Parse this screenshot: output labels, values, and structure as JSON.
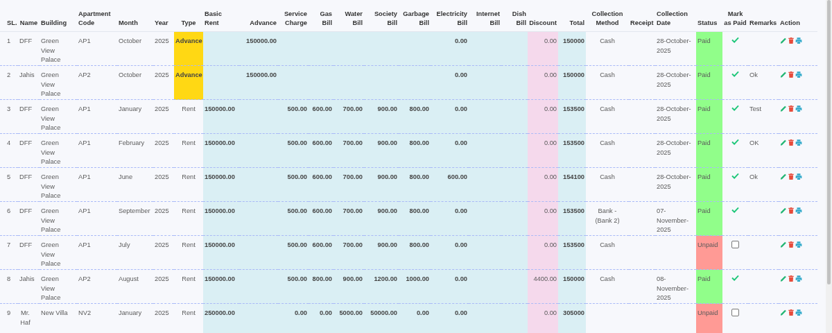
{
  "table": {
    "columns": [
      "SL.",
      "Name",
      "Building",
      "Apartment Code",
      "Month",
      "Year",
      "Type",
      "Basic Rent",
      "Advance",
      "Service Charge",
      "Gas Bill",
      "Water Bill",
      "Society Bill",
      "Garbage Bill",
      "Electricity Bill",
      "Internet Bill",
      "Dish Bill",
      "Discount",
      "Total",
      "Collection Method",
      "Receipt",
      "Collection Date",
      "Status",
      "Mark as Paid",
      "Remarks",
      "Action"
    ],
    "rows": [
      {
        "sl": "1",
        "name": "DFF",
        "building": "Green View Palace",
        "apartment_code": "AP1",
        "month": "October",
        "year": "2025",
        "type": "Advance",
        "type_highlighted": true,
        "advance": "150000.00",
        "electricity_bill": "0.00",
        "discount": "0.00",
        "total": "150000",
        "collection_method": "Cash",
        "collection_date": "28-October-2025",
        "status": "Paid",
        "paid": true
      },
      {
        "sl": "2",
        "name": "Jahis",
        "building": "Green View Palace",
        "apartment_code": "AP2",
        "month": "October",
        "year": "2025",
        "type": "Advance",
        "type_highlighted": true,
        "advance": "150000.00",
        "electricity_bill": "0.00",
        "discount": "0.00",
        "total": "150000",
        "collection_method": "Cash",
        "collection_date": "28-October-2025",
        "status": "Paid",
        "paid": true,
        "remarks": "Ok"
      },
      {
        "sl": "3",
        "name": "DFF",
        "building": "Green View Palace",
        "apartment_code": "AP1",
        "month": "January",
        "year": "2025",
        "type": "Rent",
        "type_highlighted": false,
        "basic_rent": "150000.00",
        "service_charge": "500.00",
        "gas_bill": "600.00",
        "water_bill": "700.00",
        "society_bill": "900.00",
        "garbage_bill": "800.00",
        "electricity_bill": "0.00",
        "discount": "0.00",
        "total": "153500",
        "collection_method": "Cash",
        "collection_date": "28-October-2025",
        "status": "Paid",
        "paid": true,
        "remarks": "Test"
      },
      {
        "sl": "4",
        "name": "DFF",
        "building": "Green View Palace",
        "apartment_code": "AP1",
        "month": "February",
        "year": "2025",
        "type": "Rent",
        "type_highlighted": false,
        "basic_rent": "150000.00",
        "service_charge": "500.00",
        "gas_bill": "600.00",
        "water_bill": "700.00",
        "society_bill": "900.00",
        "garbage_bill": "800.00",
        "electricity_bill": "0.00",
        "discount": "0.00",
        "total": "153500",
        "collection_method": "Cash",
        "collection_date": "28-October-2025",
        "status": "Paid",
        "paid": true,
        "remarks": "OK"
      },
      {
        "sl": "5",
        "name": "DFF",
        "building": "Green View Palace",
        "apartment_code": "AP1",
        "month": "June",
        "year": "2025",
        "type": "Rent",
        "type_highlighted": false,
        "basic_rent": "150000.00",
        "service_charge": "500.00",
        "gas_bill": "600.00",
        "water_bill": "700.00",
        "society_bill": "900.00",
        "garbage_bill": "800.00",
        "electricity_bill": "600.00",
        "discount": "0.00",
        "total": "154100",
        "collection_method": "Cash",
        "collection_date": "28-October-2025",
        "status": "Paid",
        "paid": true,
        "remarks": "Ok"
      },
      {
        "sl": "6",
        "name": "DFF",
        "building": "Green View Palace",
        "apartment_code": "AP1",
        "month": "September",
        "year": "2025",
        "type": "Rent",
        "type_highlighted": false,
        "basic_rent": "150000.00",
        "service_charge": "500.00",
        "gas_bill": "600.00",
        "water_bill": "700.00",
        "society_bill": "900.00",
        "garbage_bill": "800.00",
        "electricity_bill": "0.00",
        "discount": "0.00",
        "total": "153500",
        "collection_method": "Bank - (Bank 2)",
        "collection_date": "07-November-2025",
        "status": "Paid",
        "paid": true
      },
      {
        "sl": "7",
        "name": "DFF",
        "building": "Green View Palace",
        "apartment_code": "AP1",
        "month": "July",
        "year": "2025",
        "type": "Rent",
        "type_highlighted": false,
        "basic_rent": "150000.00",
        "service_charge": "500.00",
        "gas_bill": "600.00",
        "water_bill": "700.00",
        "society_bill": "900.00",
        "garbage_bill": "800.00",
        "electricity_bill": "0.00",
        "discount": "0.00",
        "total": "153500",
        "collection_method": "Cash",
        "status": "Unpaid",
        "paid": false
      },
      {
        "sl": "8",
        "name": "Jahis",
        "building": "Green View Palace",
        "apartment_code": "AP2",
        "month": "August",
        "year": "2025",
        "type": "Rent",
        "type_highlighted": false,
        "basic_rent": "150000.00",
        "service_charge": "500.00",
        "gas_bill": "800.00",
        "water_bill": "900.00",
        "society_bill": "1200.00",
        "garbage_bill": "1000.00",
        "electricity_bill": "0.00",
        "discount": "4400.00",
        "total": "150000",
        "collection_method": "Cash",
        "collection_date": "08-November-2025",
        "status": "Paid",
        "paid": true
      },
      {
        "sl": "9",
        "name": "Mr. Haf",
        "building": "New Villa",
        "apartment_code": "NV2",
        "month": "January",
        "year": "2025",
        "type": "Rent",
        "type_highlighted": false,
        "basic_rent": "250000.00",
        "service_charge": "0.00",
        "gas_bill": "0.00",
        "water_bill": "5000.00",
        "society_bill": "50000.00",
        "garbage_bill": "0.00",
        "electricity_bill": "0.00",
        "discount": "0.00",
        "total": "305000",
        "status": "Unpaid",
        "paid": false
      }
    ]
  }
}
